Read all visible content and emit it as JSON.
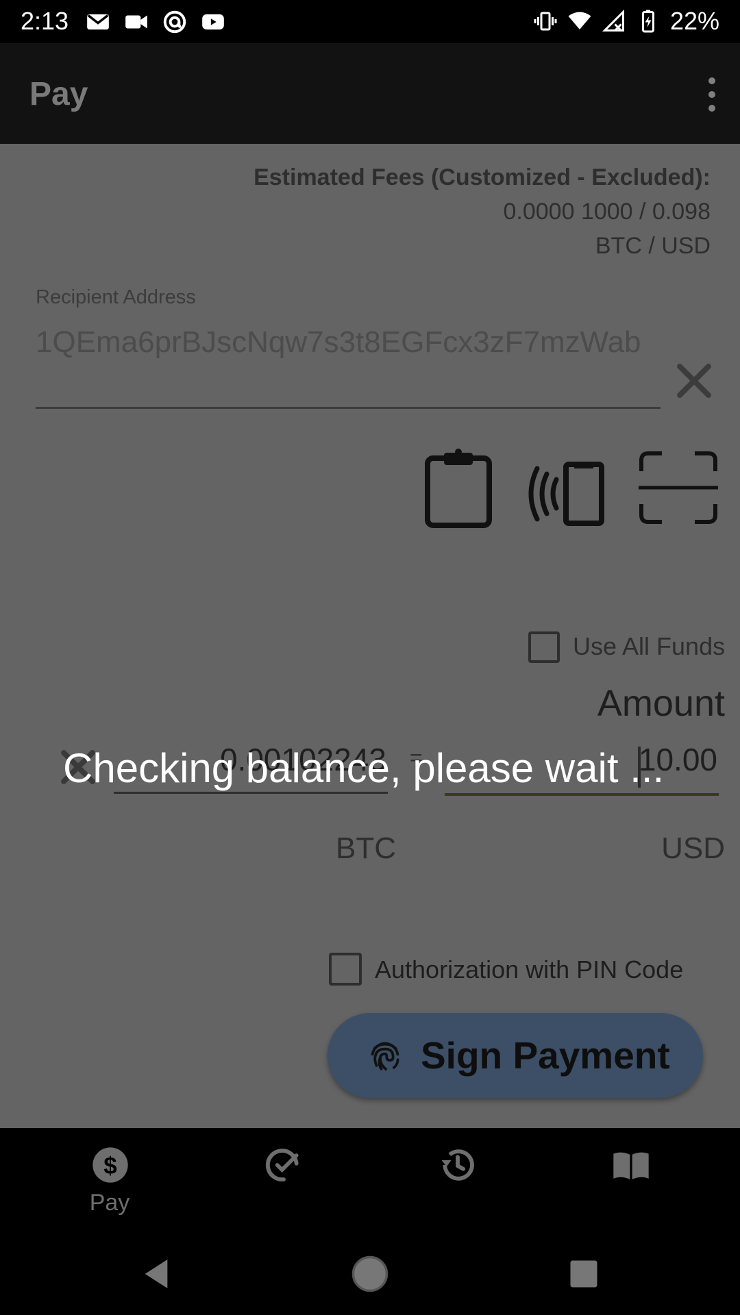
{
  "status_bar": {
    "time": "2:13",
    "battery": "22%",
    "left_icons": [
      "gmail-icon",
      "video-camera-icon",
      "at-sign-icon",
      "youtube-icon"
    ],
    "right_icons": [
      "vibrate-icon",
      "wifi-icon",
      "no-signal-icon",
      "battery-charging-icon"
    ]
  },
  "app_bar": {
    "title": "Pay",
    "menu_icon": "more-vertical-icon"
  },
  "fees": {
    "label": "Estimated Fees (Customized - Excluded):",
    "value": "0.0000 1000 / 0.098",
    "unit": "BTC / USD"
  },
  "recipient": {
    "label": "Recipient Address",
    "value": "1QEma6prBJscNqw7s3t8EGFcx3zF7mzWab",
    "clear_icon": "close-icon",
    "action_icons": [
      "clipboard-icon",
      "nfc-icon",
      "scan-icon"
    ]
  },
  "use_all_funds": {
    "label": "Use All Funds",
    "checked": false
  },
  "amount": {
    "title": "Amount",
    "btc_value": "0.00102243",
    "equals": "=",
    "usd_value": "10.00",
    "btc_unit": "BTC",
    "usd_unit": "USD"
  },
  "pin_auth": {
    "label": "Authorization with PIN Code",
    "checked": false
  },
  "sign_button": {
    "label": "Sign Payment",
    "icon": "fingerprint-icon"
  },
  "overlay": {
    "message": "Checking balance, please wait ..."
  },
  "bottom_nav": {
    "items": [
      {
        "label": "Pay",
        "icon": "dollar-icon"
      },
      {
        "label": "",
        "icon": "receive-icon"
      },
      {
        "label": "",
        "icon": "history-icon"
      },
      {
        "label": "",
        "icon": "book-icon"
      }
    ]
  },
  "colors": {
    "content_bg": "#646464",
    "app_bar_bg": "#121212",
    "button_bg": "#3c4f66",
    "overlay_text": "#ffffff"
  }
}
